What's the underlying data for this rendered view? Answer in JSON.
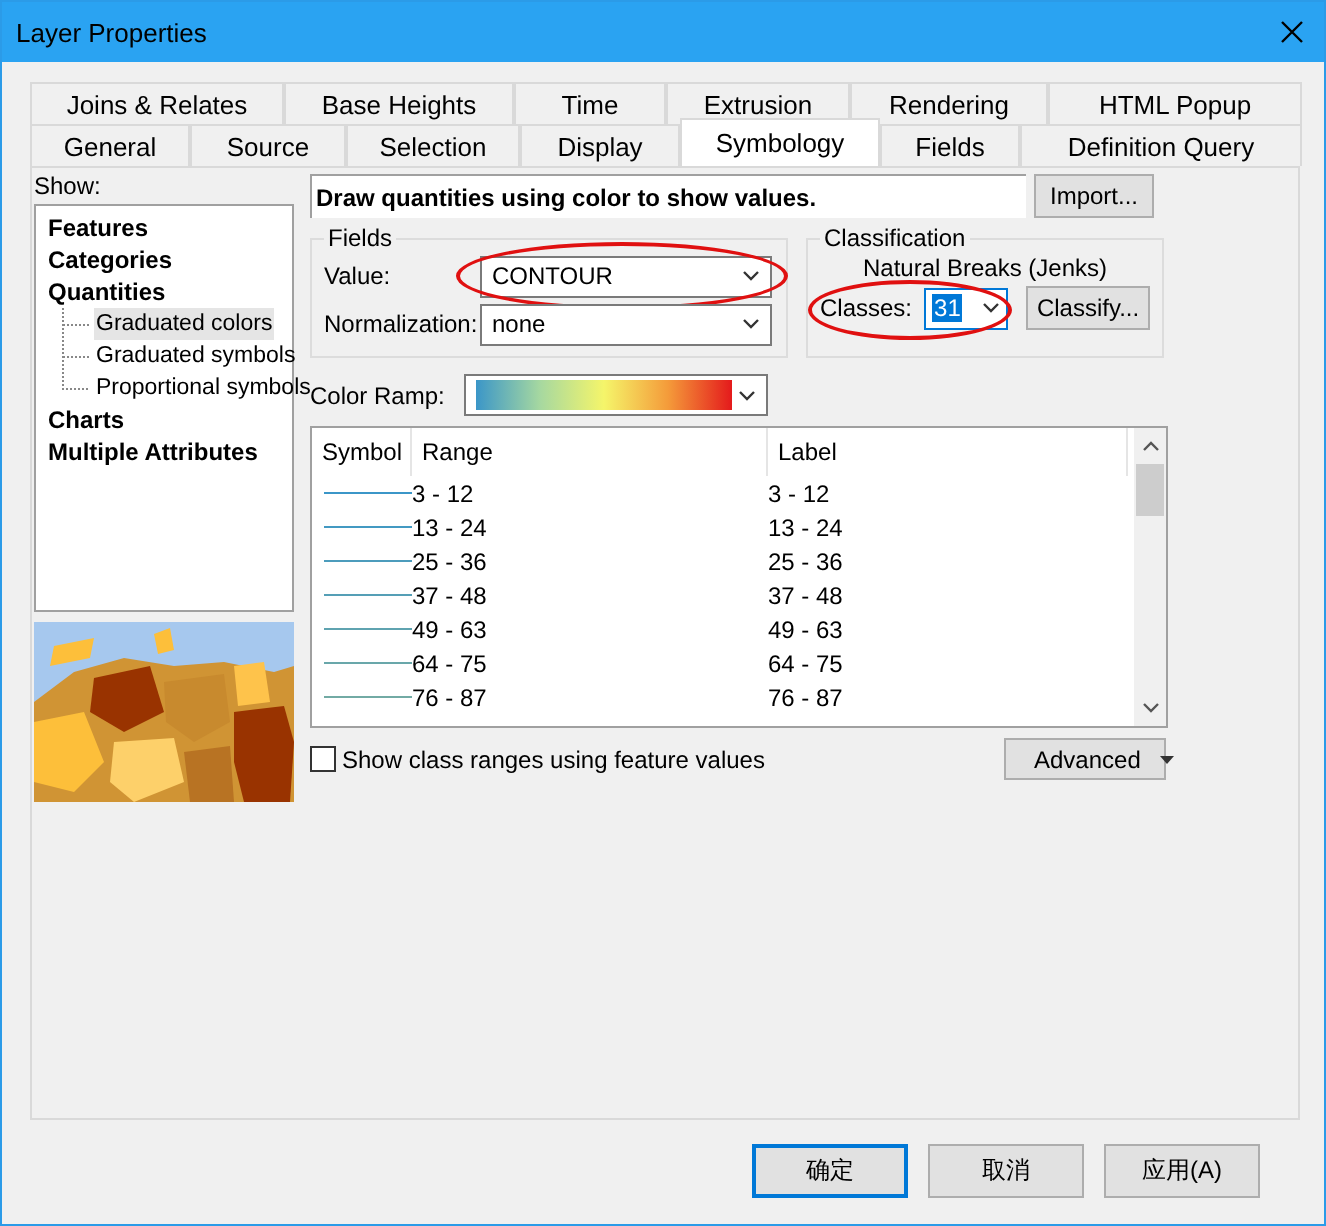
{
  "window": {
    "title": "Layer Properties"
  },
  "tabs": {
    "row1": [
      {
        "label": "Joins & Relates",
        "selected": false
      },
      {
        "label": "Base Heights",
        "selected": false
      },
      {
        "label": "Time",
        "selected": false
      },
      {
        "label": "Extrusion",
        "selected": false
      },
      {
        "label": "Rendering",
        "selected": false
      },
      {
        "label": "HTML Popup",
        "selected": false
      }
    ],
    "row2": [
      {
        "label": "General",
        "selected": false
      },
      {
        "label": "Source",
        "selected": false
      },
      {
        "label": "Selection",
        "selected": false
      },
      {
        "label": "Display",
        "selected": false
      },
      {
        "label": "Symbology",
        "selected": true
      },
      {
        "label": "Fields",
        "selected": false
      },
      {
        "label": "Definition Query",
        "selected": false
      }
    ]
  },
  "show": {
    "label": "Show:",
    "items": [
      {
        "label": "Features",
        "selected": false
      },
      {
        "label": "Categories",
        "selected": false
      },
      {
        "label": "Quantities",
        "selected": false,
        "children": [
          {
            "label": "Graduated colors",
            "selected": true
          },
          {
            "label": "Graduated symbols",
            "selected": false
          },
          {
            "label": "Proportional symbols",
            "selected": false
          }
        ]
      },
      {
        "label": "Charts",
        "selected": false
      },
      {
        "label": "Multiple Attributes",
        "selected": false
      }
    ]
  },
  "description": "Draw quantities using color to show values.",
  "import_button": "Import...",
  "fields": {
    "title": "Fields",
    "value": {
      "label": "Value:",
      "value": "CONTOUR",
      "circled": true
    },
    "normalization": {
      "label": "Normalization:",
      "value": "none"
    }
  },
  "classification": {
    "title": "Classification",
    "method": "Natural Breaks (Jenks)",
    "classes": {
      "label": "Classes:",
      "value": "31",
      "circled": true
    },
    "classify_button": "Classify..."
  },
  "color_ramp": {
    "label": "Color Ramp:"
  },
  "table": {
    "columns": [
      "Symbol",
      "Range",
      "Label"
    ],
    "rows": [
      {
        "range": "3 - 12",
        "label": "3 - 12",
        "color": "#3b96c8"
      },
      {
        "range": "13 - 24",
        "label": "13 - 24",
        "color": "#4399c2"
      },
      {
        "range": "25 - 36",
        "label": "25 - 36",
        "color": "#4c9cbc"
      },
      {
        "range": "37 - 48",
        "label": "37 - 48",
        "color": "#559fb6"
      },
      {
        "range": "49 - 63",
        "label": "49 - 63",
        "color": "#5fa3b0"
      },
      {
        "range": "64 - 75",
        "label": "64 - 75",
        "color": "#69a7aa"
      },
      {
        "range": "76 - 87",
        "label": "76 - 87",
        "color": "#72aaa4"
      }
    ]
  },
  "show_feature_values": {
    "label": "Show class ranges using feature values",
    "checked": false
  },
  "advanced_button": "Advanced",
  "buttons": [
    {
      "label": "确定",
      "default": true
    },
    {
      "label": "取消",
      "default": false
    },
    {
      "label": "应用(A)",
      "default": false
    }
  ]
}
